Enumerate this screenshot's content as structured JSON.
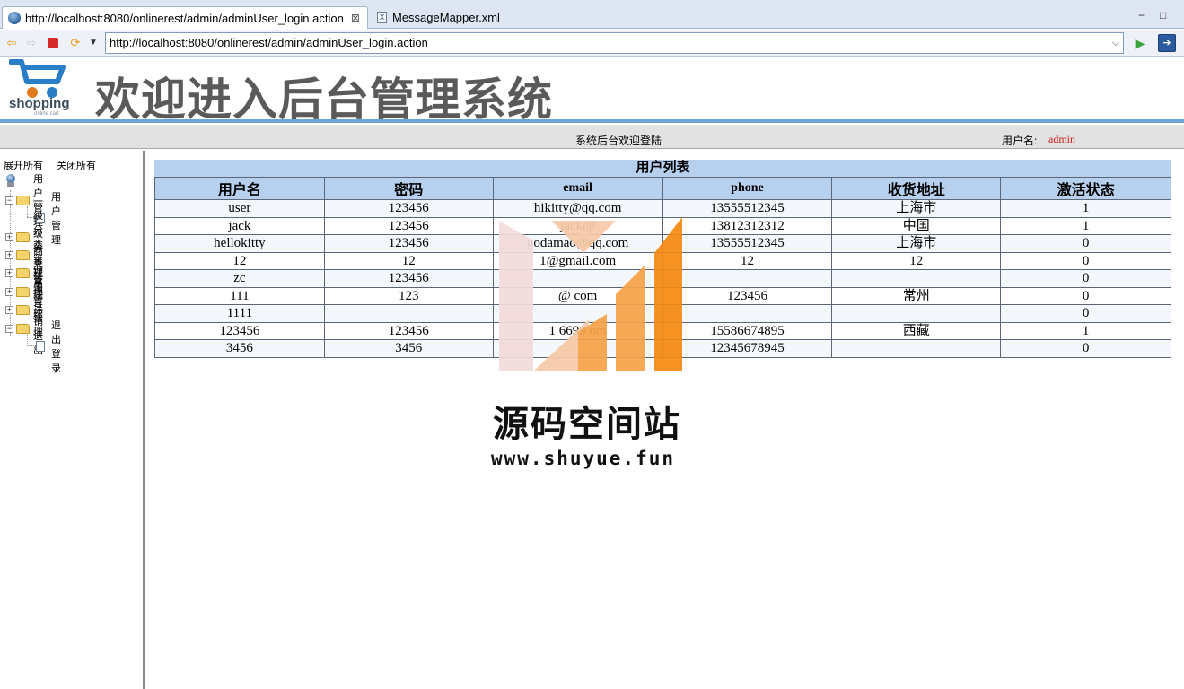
{
  "browser": {
    "tabs": [
      {
        "label": "http://localhost:8080/onlinerest/admin/adminUser_login.action",
        "active": true,
        "close": "⊠"
      },
      {
        "label": "MessageMapper.xml",
        "active": false,
        "icon_text": "X"
      }
    ],
    "window_controls": {
      "minimize": "−",
      "maximize": "□"
    },
    "url": "http://localhost:8080/onlinerest/admin/adminUser_login.action"
  },
  "header": {
    "logo_brand": "shopping",
    "logo_tagline": "online cart",
    "title": "欢迎进入后台管理系统"
  },
  "status": {
    "welcome": "系统后台欢迎登陆",
    "user_label": "用户名:",
    "username": "admin"
  },
  "sidebar": {
    "expand_all": "展开所有",
    "collapse_all": "关闭所有",
    "tree": [
      {
        "label": "用户管理",
        "expanded": true,
        "children": [
          "用户管理"
        ]
      },
      {
        "label": "一级分类管理",
        "expanded": false
      },
      {
        "label": "二级分类管理",
        "expanded": false
      },
      {
        "label": "商品管理",
        "expanded": false
      },
      {
        "label": "订单管理",
        "expanded": false
      },
      {
        "label": "留言管理",
        "expanded": false
      },
      {
        "label": "注销退出",
        "expanded": true,
        "children": [
          "退出登录"
        ]
      }
    ]
  },
  "user_table": {
    "caption": "用户列表",
    "headers": [
      "用户名",
      "密码",
      "email",
      "phone",
      "收货地址",
      "激活状态"
    ],
    "rows": [
      [
        "user",
        "123456",
        "hikitty@qq.com",
        "13555512345",
        "上海市",
        "1"
      ],
      [
        "jack",
        "123456",
        "jack@",
        "13812312312",
        "中国",
        "1"
      ],
      [
        "hellokitty",
        "123456",
        "nodamao@qq.com",
        "13555512345",
        "上海市",
        "0"
      ],
      [
        "12",
        "12",
        "1@gmail.com",
        "12",
        "12",
        "0"
      ],
      [
        "zc",
        "123456",
        "",
        "",
        "",
        "0"
      ],
      [
        "111",
        "123",
        "@ com",
        "123456",
        "常州",
        "0"
      ],
      [
        "1111",
        "",
        "",
        "",
        "",
        "0"
      ],
      [
        "123456",
        "123456",
        "1 6699 om",
        "15586674895",
        "西藏",
        "1"
      ],
      [
        "3456",
        "3456",
        "",
        "12345678945",
        "",
        "0"
      ]
    ]
  },
  "watermark": {
    "title": "源码空间站",
    "url": "www.shuyue.fun",
    "colors": [
      "#f2dcda",
      "#f6caa8",
      "#f7a349",
      "#f58a12"
    ]
  }
}
